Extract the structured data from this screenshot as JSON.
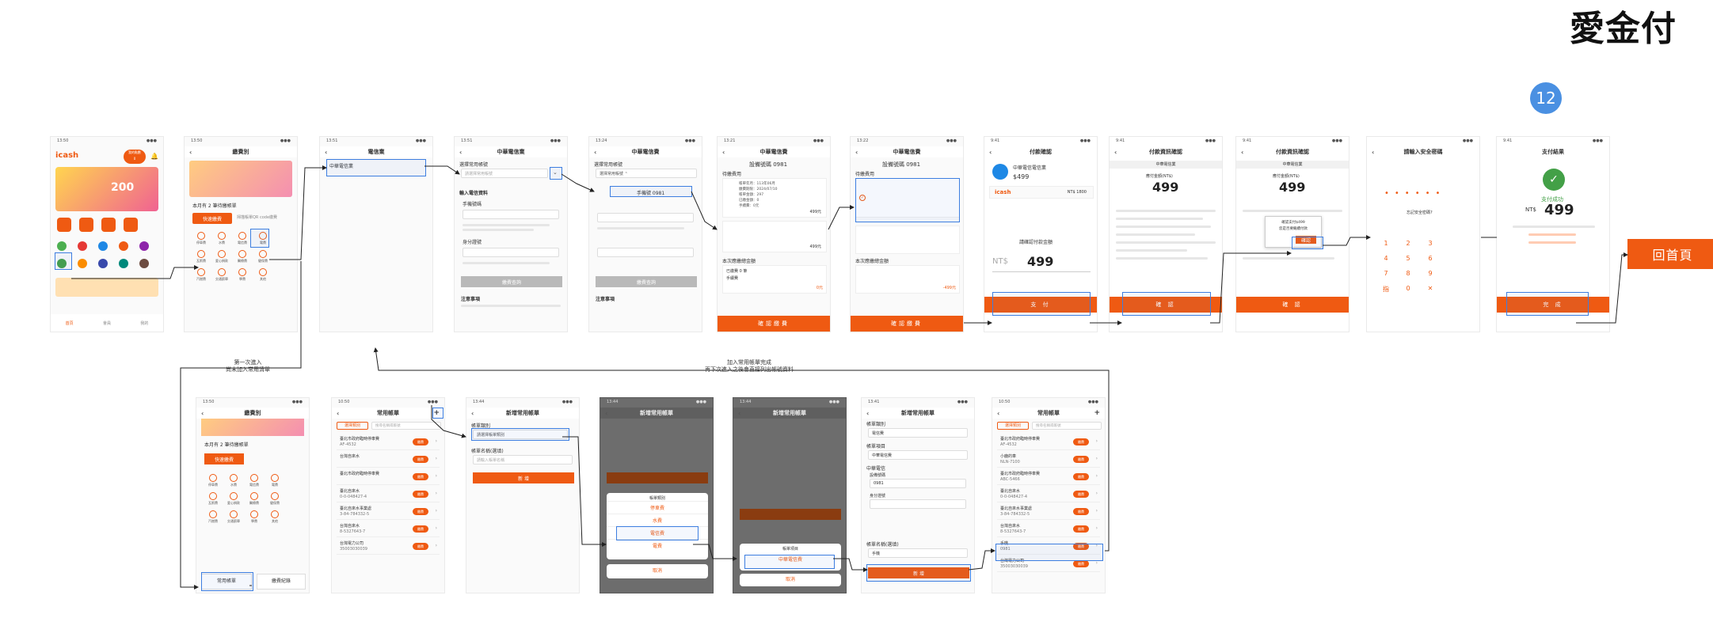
{
  "header": {
    "title": "愛金付",
    "step": "12"
  },
  "screens": {
    "s1": {
      "time": "13:50",
      "balance_label": "我的點數",
      "points": "0",
      "brand": "icash",
      "promo": "200",
      "nav_home": "首頁",
      "nav_member": "會員",
      "nav_my": "我的"
    },
    "s2": {
      "title": "繳費別",
      "notice": "本月有 2 筆待繳帳單",
      "quick_pay": "快速繳費",
      "quick_hint": "掃描帳單QR code繳費",
      "items": [
        "停車費",
        "水費",
        "電信費",
        "電費",
        "瓦斯費",
        "愛心捐款",
        "醫療費",
        "健保費",
        "汽燃費",
        "交通罰單",
        "學費",
        "其他"
      ]
    },
    "s3": {
      "title": "電信業",
      "selected": "中華電信業"
    },
    "s4": {
      "title": "中華電信業",
      "section1": "選擇常用帳號",
      "select_placeholder": "請選擇常用帳號",
      "section2": "輸入電信資料",
      "phone_label": "手機號碼",
      "id_label": "身分證號",
      "btn": "繳費查詢",
      "notes": "注意事項"
    },
    "s5": {
      "title": "中華電信費",
      "section1": "選擇常用帳號",
      "option": "手機號 0981",
      "btn": "繳費查詢",
      "notes": "注意事項"
    },
    "s6": {
      "title": "中華電信費",
      "phone": "設備號碼 0981",
      "section": "待繳費用",
      "rows": [
        "帳單年月：113年06月",
        "繳費期限：2024/07/10",
        "帳單金額：297",
        "已繳金額：0",
        "手續費：0元"
      ],
      "amount1": "499元",
      "amount2": "499元",
      "paid": "已繳費 0 筆",
      "fee": "手續費",
      "total": "0元",
      "btn": "確認繳費"
    },
    "s7": {
      "title": "中華電信費",
      "phone": "設備號碼 0981",
      "section": "待繳費用",
      "total": "-499元",
      "btn": "確認繳費"
    },
    "s8": {
      "time": "9:41",
      "title": "付款確認",
      "merchant": "中華電信電信業",
      "price": "$499",
      "brand": "icash",
      "balance": "NT$ 1800",
      "label": "請確認付款金額",
      "currency": "NT$",
      "amount": "499",
      "btn": "支 付"
    },
    "s9": {
      "time": "9:41",
      "title": "付款資訊確認",
      "sub": "中華電信業",
      "label": "應付金額(NT$)",
      "amount": "499",
      "btn": "確 認"
    },
    "s10": {
      "time": "9:41",
      "title": "付款資訊確認",
      "sub": "中華電信業",
      "label": "應付金額(NT$)",
      "amount": "499",
      "popup1": "確認支付$499",
      "popup2": "您是否要繼續付款",
      "popup_btn": "確認",
      "btn": "確 認"
    },
    "s11": {
      "title": "請輸入安全密碼",
      "sub": "忘記安全密碼?",
      "keys": [
        "1",
        "2",
        "3",
        "4",
        "5",
        "6",
        "7",
        "8",
        "9",
        "指",
        "0",
        "✕"
      ]
    },
    "s12": {
      "time": "9:41",
      "title": "支付結果",
      "status": "支付成功",
      "currency": "NT$",
      "amount": "499",
      "btn": "完 成"
    },
    "b1": {
      "title": "繳費別",
      "notice": "本月有 2 筆待繳帳單",
      "quick_pay": "快速繳費",
      "items": [
        "停車費",
        "水費",
        "電信費",
        "電費",
        "瓦斯費",
        "愛心捐款",
        "醫療費",
        "健保費",
        "汽燃費",
        "交通罰單",
        "學費",
        "其他"
      ],
      "common": "常用帳單",
      "history": "繳費紀錄"
    },
    "b2": {
      "title": "常用帳單",
      "filter": "選擇類別",
      "search": "搜尋名稱或帳號",
      "rows": [
        [
          "臺北市政府臨時停車費",
          "AF-4532"
        ],
        [
          "台灣自來水",
          ""
        ],
        [
          "臺北市政府臨時停車費",
          ""
        ],
        [
          "臺北自來水",
          "0-0-048427-4"
        ],
        [
          "臺北自來水事業處",
          "3-84-784332-5"
        ],
        [
          "台灣自來水",
          "8-5327643-7"
        ],
        [
          "台灣電力公司",
          "35003030039"
        ]
      ],
      "pill": "繳費"
    },
    "b3": {
      "title": "新增常用帳單",
      "type_label": "帳單類別",
      "type_value": "請選擇帳單類別",
      "name_label": "帳單名稱(選填)",
      "name_hint": "請輸入帳單名稱",
      "btn": "新 增"
    },
    "b4": {
      "title": "新增常用帳單",
      "sheet_title": "帳單類別",
      "options": [
        "停車費",
        "水費",
        "電信費",
        "電費"
      ],
      "cancel": "取消"
    },
    "b5": {
      "title": "新增常用帳單",
      "sheet_title": "帳單項目",
      "option": "中華電信費",
      "cancel": "取消"
    },
    "b6": {
      "title": "新增常用帳單",
      "type_label": "帳單類別",
      "type_value": "電信費",
      "item_label": "帳單項目",
      "item_value": "中華電信費",
      "info_label": "中華電信",
      "phone_label": "設備號碼",
      "phone_value": "0981",
      "id_label": "身分證號",
      "name_label": "帳單名稱(選填)",
      "name_value": "手機",
      "btn": "新 增"
    },
    "b7": {
      "title": "常用帳單",
      "filter": "選擇類別",
      "search": "搜尋名稱或帳號",
      "rows": [
        [
          "臺北市政府臨時停車費",
          "AF-4532"
        ],
        [
          "小鹿的車",
          "NLN-7100"
        ],
        [
          "臺北市政府臨時停車費",
          "ABC-5466"
        ],
        [
          "臺北自來水",
          "0-0-048427-4"
        ],
        [
          "臺北自來水事業處",
          "3-84-784332-5"
        ],
        [
          "台灣自來水",
          "8-5327643-7"
        ],
        [
          "手機",
          "0981"
        ],
        [
          "台灣電力公司",
          "35003030039"
        ]
      ],
      "pill": "繳費"
    }
  },
  "notes": {
    "first_entry": "第一次進入\n尚未加入常用清單",
    "added": "加入常用帳單完成\n再下次進入之後會直接列出帳號資料"
  },
  "home_button": "回首頁"
}
